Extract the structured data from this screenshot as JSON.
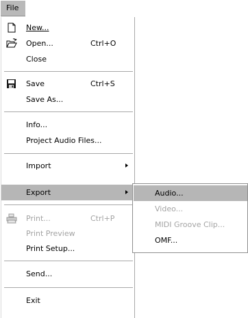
{
  "menubar": {
    "file_label": "File"
  },
  "file_menu": {
    "new_label": "New...",
    "open_label": "Open...",
    "open_shortcut": "Ctrl+O",
    "close_label": "Close",
    "save_label": "Save",
    "save_shortcut": "Ctrl+S",
    "save_as_label": "Save As...",
    "info_label": "Info...",
    "project_audio_files_label": "Project Audio Files...",
    "import_label": "Import",
    "export_label": "Export",
    "print_label": "Print...",
    "print_shortcut": "Ctrl+P",
    "print_preview_label": "Print Preview",
    "print_setup_label": "Print Setup...",
    "send_label": "Send...",
    "exit_label": "Exit"
  },
  "export_submenu": {
    "audio_label": "Audio...",
    "video_label": "Video...",
    "midi_groove_clip_label": "MIDI Groove Clip...",
    "omf_label": "OMF..."
  },
  "icons": {
    "new": "new-document-icon",
    "open": "open-folder-icon",
    "save": "floppy-disk-icon",
    "print": "printer-icon",
    "submenu_arrow": "chevron-right-icon"
  },
  "colors": {
    "highlight": "#b6b6b6",
    "disabled_text": "#a3a3a3",
    "menubar_active": "#b9b9b9"
  }
}
